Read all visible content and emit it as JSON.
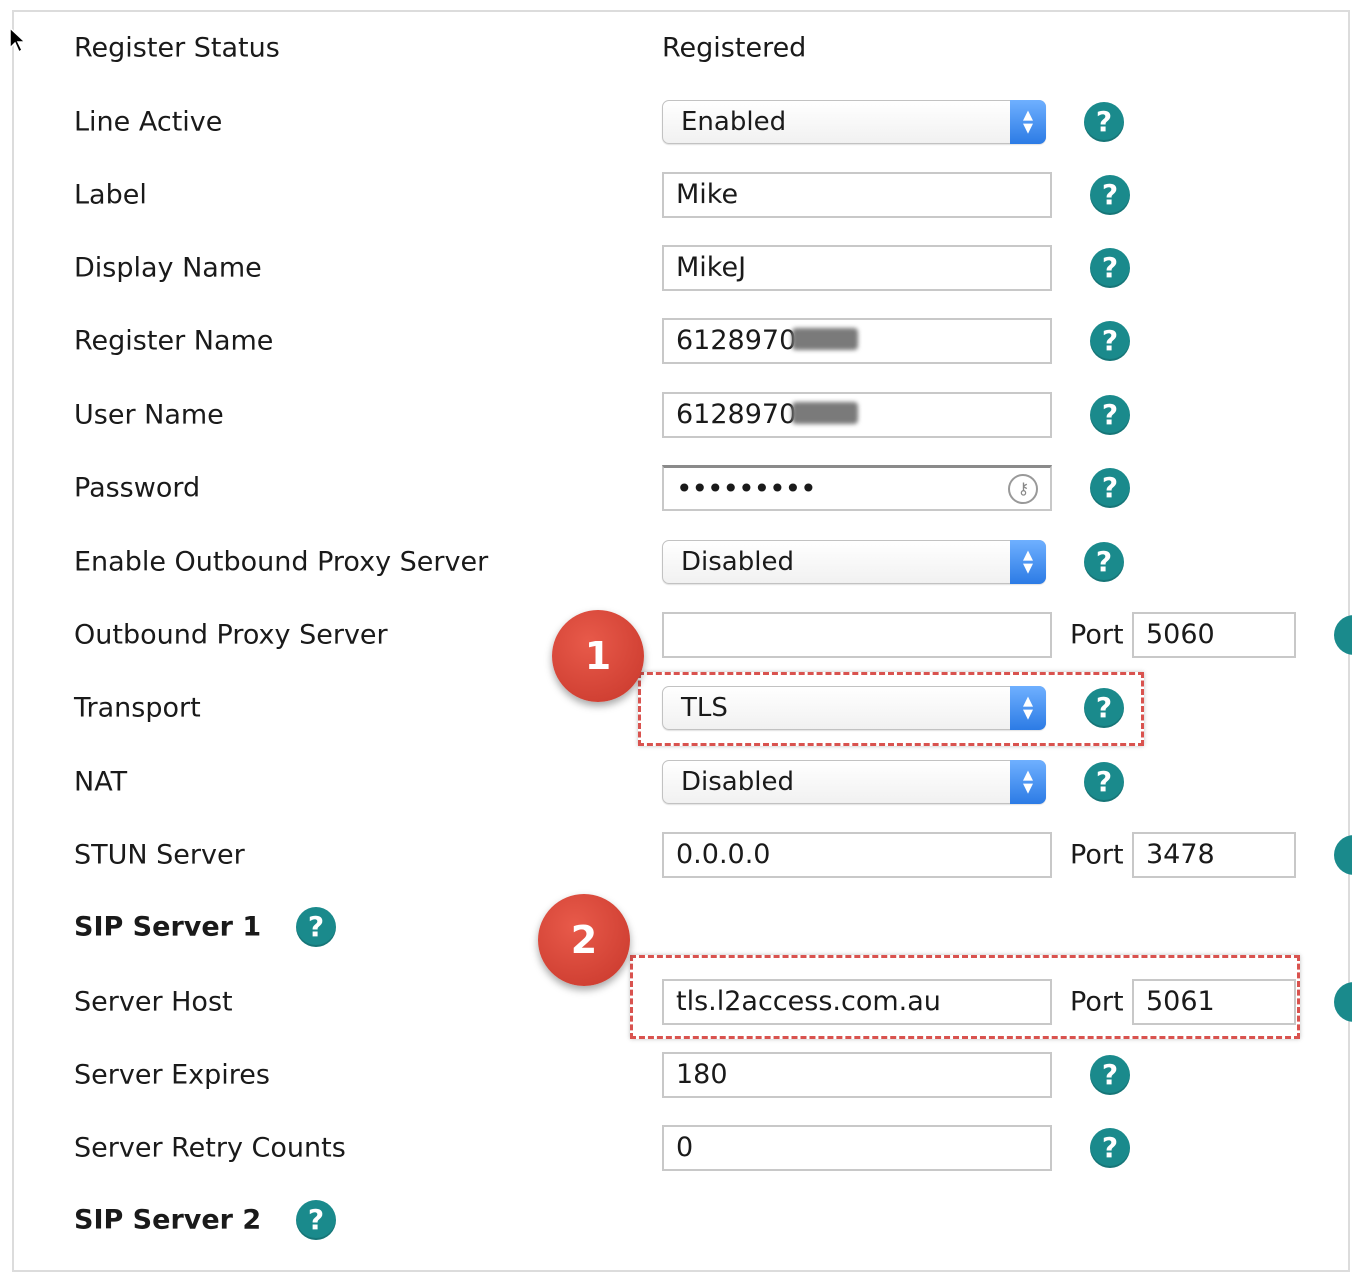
{
  "rows": {
    "register_status": {
      "label": "Register Status",
      "value": "Registered"
    },
    "line_active": {
      "label": "Line Active",
      "value": "Enabled"
    },
    "label": {
      "label": "Label",
      "value": "Mike"
    },
    "display_name": {
      "label": "Display Name",
      "value": "MikeJ"
    },
    "register_name": {
      "label": "Register Name",
      "value": "6128970"
    },
    "user_name": {
      "label": "User Name",
      "value": "6128970"
    },
    "password": {
      "label": "Password",
      "value": "•••••••••"
    },
    "outbound_proxy_enable": {
      "label": "Enable Outbound Proxy Server",
      "value": "Disabled"
    },
    "outbound_proxy_server": {
      "label": "Outbound Proxy Server",
      "value": "",
      "port_label": "Port",
      "port": "5060"
    },
    "transport": {
      "label": "Transport",
      "value": "TLS"
    },
    "nat": {
      "label": "NAT",
      "value": "Disabled"
    },
    "stun_server": {
      "label": "STUN Server",
      "value": "0.0.0.0",
      "port_label": "Port",
      "port": "3478"
    },
    "sip_server_1": {
      "label": "SIP Server 1"
    },
    "server_host": {
      "label": "Server Host",
      "value": "tls.l2access.com.au",
      "port_label": "Port",
      "port": "5061"
    },
    "server_expires": {
      "label": "Server Expires",
      "value": "180"
    },
    "server_retry_counts": {
      "label": "Server Retry Counts",
      "value": "0"
    },
    "sip_server_2": {
      "label": "SIP Server 2"
    }
  },
  "help_glyph": "?",
  "callouts": [
    "1",
    "2"
  ],
  "colors": {
    "help": "#1a8a8c",
    "callout": "#d9483b",
    "select_arrow": "#2c7be5"
  }
}
